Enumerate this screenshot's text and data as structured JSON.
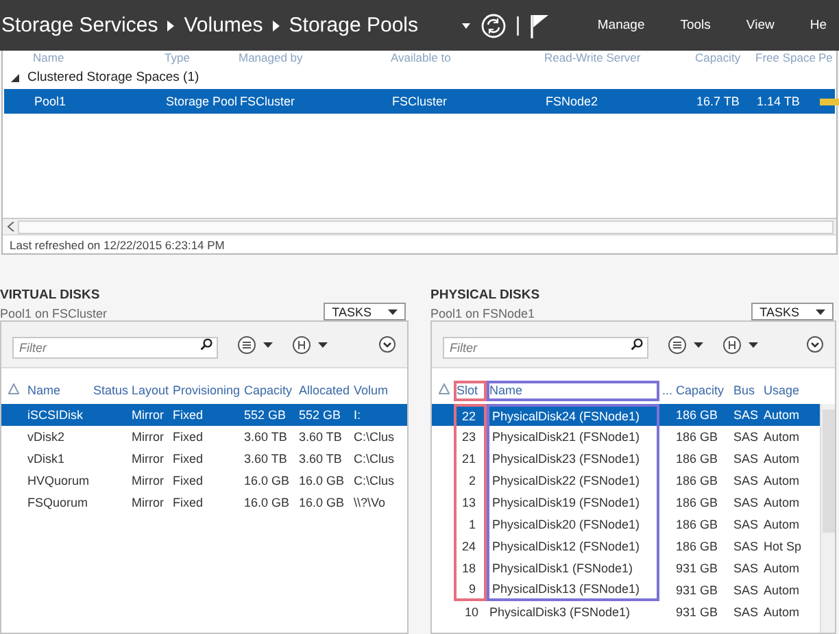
{
  "title_bar": {
    "breadcrumb": [
      "Storage Services",
      "Volumes",
      "Storage Pools"
    ],
    "menu": [
      "Manage",
      "Tools",
      "View",
      "He"
    ]
  },
  "storage_pools": {
    "columns": [
      "Name",
      "Type",
      "Managed by",
      "Available to",
      "Read-Write Server",
      "Capacity",
      "Free Space",
      "Pe"
    ],
    "groups": [
      {
        "label": "Clustered Storage Spaces (1)",
        "expanded": true,
        "rows": [
          {
            "cells": [
              "Pool1",
              "Storage Pool",
              "FSCluster",
              "FSCluster",
              "FSNode2",
              "16.7 TB",
              "1.14 TB"
            ],
            "selected": true
          }
        ]
      }
    ],
    "status": "Last refreshed on 12/22/2015 6:23:14 PM"
  },
  "virtual_disks": {
    "title": "VIRTUAL DISKS",
    "subtitle": "Pool1 on FSCluster",
    "tasks": "TASKS",
    "filter_placeholder": "Filter",
    "columns": [
      {
        "label": "Name"
      },
      {
        "label": "Status"
      },
      {
        "label": "Layout"
      },
      {
        "label": "Provisioning"
      },
      {
        "label": "Capacity"
      },
      {
        "label": "Allocated"
      },
      {
        "label": "Volum"
      }
    ],
    "rows": [
      {
        "cells": [
          "iSCSIDisk",
          null,
          "Mirror",
          "Fixed",
          "552 GB",
          "552 GB",
          "I:"
        ],
        "selected": true
      },
      {
        "cells": [
          "vDisk2",
          null,
          "Mirror",
          "Fixed",
          "3.60 TB",
          "3.60 TB",
          "C:\\Clus"
        ],
        "selected": false
      },
      {
        "cells": [
          "vDisk1",
          null,
          "Mirror",
          "Fixed",
          "3.60 TB",
          "3.60 TB",
          "C:\\Clus"
        ],
        "selected": false
      },
      {
        "cells": [
          "HVQuorum",
          null,
          "Mirror",
          "Fixed",
          "16.0 GB",
          "16.0 GB",
          "C:\\Clus"
        ],
        "selected": false
      },
      {
        "cells": [
          "FSQuorum",
          null,
          "Mirror",
          "Fixed",
          "16.0 GB",
          "16.0 GB",
          "\\\\?\\Vo"
        ],
        "selected": false
      }
    ]
  },
  "physical_disks": {
    "title": "PHYSICAL DISKS",
    "subtitle": "Pool1 on FSNode1",
    "tasks": "TASKS",
    "filter_placeholder": "Filter",
    "columns": [
      {
        "label": "Slot",
        "color": "#e57080"
      },
      {
        "label": "Name",
        "color": "#7b72d6"
      },
      {
        "label": "..."
      },
      {
        "label": "Capacity"
      },
      {
        "label": "Bus"
      },
      {
        "label": "Usage"
      }
    ],
    "rows": [
      {
        "cells": [
          "22",
          "PhysicalDisk24 (FSNode1)",
          null,
          "186 GB",
          "SAS",
          "Autom"
        ],
        "selected": true,
        "framed": true
      },
      {
        "cells": [
          "23",
          "PhysicalDisk21 (FSNode1)",
          null,
          "186 GB",
          "SAS",
          "Autom"
        ],
        "selected": false,
        "framed": true
      },
      {
        "cells": [
          "21",
          "PhysicalDisk23 (FSNode1)",
          null,
          "186 GB",
          "SAS",
          "Autom"
        ],
        "selected": false,
        "framed": true
      },
      {
        "cells": [
          "2",
          "PhysicalDisk22 (FSNode1)",
          null,
          "186 GB",
          "SAS",
          "Autom"
        ],
        "selected": false,
        "framed": true
      },
      {
        "cells": [
          "13",
          "PhysicalDisk19 (FSNode1)",
          null,
          "186 GB",
          "SAS",
          "Autom"
        ],
        "selected": false,
        "framed": true
      },
      {
        "cells": [
          "1",
          "PhysicalDisk20 (FSNode1)",
          null,
          "186 GB",
          "SAS",
          "Autom"
        ],
        "selected": false,
        "framed": true
      },
      {
        "cells": [
          "24",
          "PhysicalDisk12 (FSNode1)",
          null,
          "186 GB",
          "SAS",
          "Hot Sp"
        ],
        "selected": false,
        "framed": true
      },
      {
        "cells": [
          "18",
          "PhysicalDisk1 (FSNode1)",
          null,
          "931 GB",
          "SAS",
          "Autom"
        ],
        "selected": false,
        "framed": true
      },
      {
        "cells": [
          "9",
          "PhysicalDisk13 (FSNode1)",
          null,
          "931 GB",
          "SAS",
          "Autom"
        ],
        "selected": false,
        "framed": true
      },
      {
        "cells": [
          "10",
          "PhysicalDisk3 (FSNode1)",
          null,
          "931 GB",
          "SAS",
          "Autom"
        ],
        "selected": false,
        "framed": false
      }
    ]
  }
}
